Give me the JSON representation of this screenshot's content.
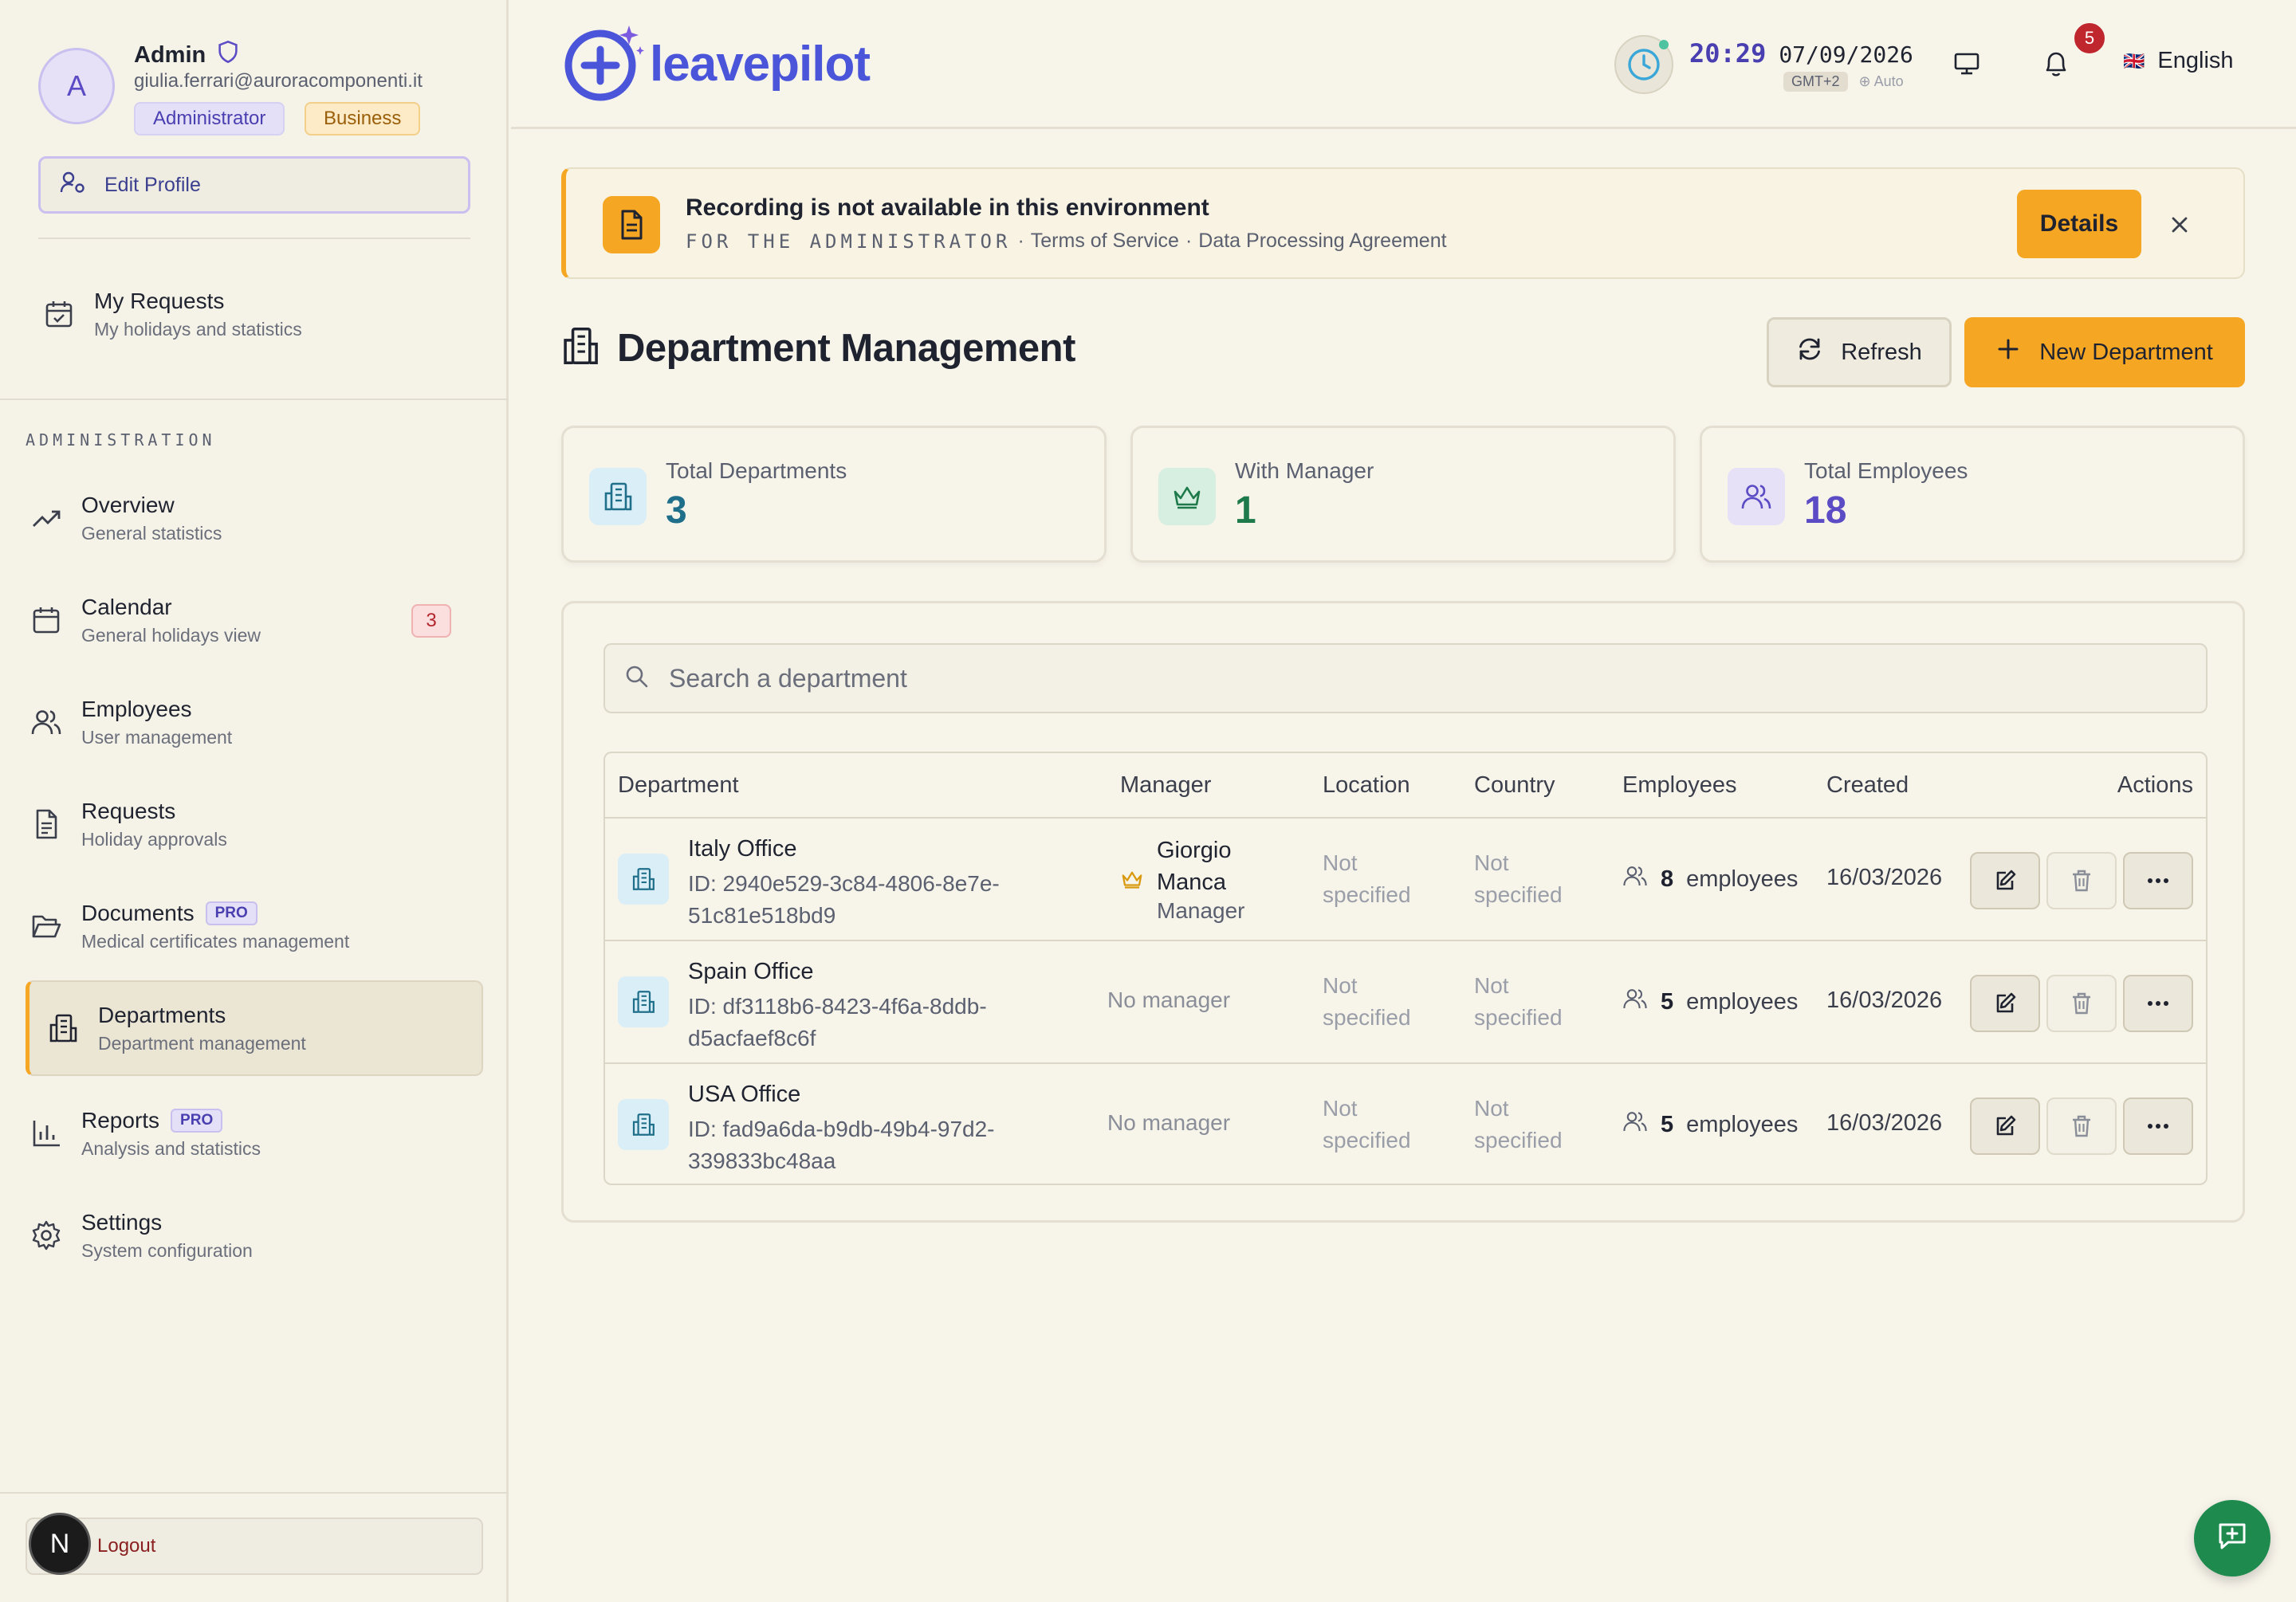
{
  "profile": {
    "initial": "A",
    "name": "Admin",
    "email": "giulia.ferrari@auroracomponenti.it",
    "role_badge": "Administrator",
    "plan_badge": "Business",
    "edit_label": "Edit Profile"
  },
  "sidebar": {
    "my_requests": {
      "title": "My Requests",
      "subtitle": "My holidays and statistics"
    },
    "section_label": "ADMINISTRATION",
    "items": [
      {
        "title": "Overview",
        "subtitle": "General statistics"
      },
      {
        "title": "Calendar",
        "subtitle": "General holidays view",
        "count": "3"
      },
      {
        "title": "Employees",
        "subtitle": "User management"
      },
      {
        "title": "Requests",
        "subtitle": "Holiday approvals"
      },
      {
        "title": "Documents",
        "subtitle": "Medical certificates management",
        "badge": "PRO"
      },
      {
        "title": "Departments",
        "subtitle": "Department management"
      },
      {
        "title": "Reports",
        "subtitle": "Analysis and statistics",
        "badge": "PRO"
      },
      {
        "title": "Settings",
        "subtitle": "System configuration"
      }
    ],
    "logout_label": "Logout",
    "next_logo": "N"
  },
  "header": {
    "logo_text": "leavepilot",
    "time": "20:29",
    "date": "07/09/2026",
    "timezone": "GMT+2",
    "tz_mode": "⊕ Auto",
    "notification_count": "5",
    "language": "English",
    "flag": "🇬🇧"
  },
  "banner": {
    "title": "Recording is not available in this environment",
    "prefix": "FOR THE ADMINISTRATOR",
    "sep1": "·",
    "link1": "Terms of Service",
    "sep2": "·",
    "link2": "Data Processing Agreement",
    "details_label": "Details"
  },
  "page": {
    "title": "Department Management",
    "refresh_label": "Refresh",
    "new_label": "New Department"
  },
  "stats": [
    {
      "label": "Total Departments",
      "value": "3",
      "color": "#1f6f8b"
    },
    {
      "label": "With Manager",
      "value": "1",
      "color": "#1e7a4a"
    },
    {
      "label": "Total Employees",
      "value": "18",
      "color": "#5b4bc4"
    }
  ],
  "search": {
    "placeholder": "Search a department"
  },
  "table": {
    "headers": [
      "Department",
      "Manager",
      "Location",
      "Country",
      "Employees",
      "Created",
      "Actions"
    ],
    "rows": [
      {
        "name": "Italy Office",
        "id": "ID: 2940e529-3c84-4806-8e7e-51c81e518bd9",
        "manager_name": "Giorgio Manca",
        "manager_role": "Manager",
        "location": "Not specified",
        "country": "Not specified",
        "employees_count": "8",
        "employees_label": "employees",
        "created": "16/03/2026"
      },
      {
        "name": "Spain Office",
        "id": "ID: df3118b6-8423-4f6a-8ddb-d5acfaef8c6f",
        "manager_name": "No manager",
        "location": "Not specified",
        "country": "Not specified",
        "employees_count": "5",
        "employees_label": "employees",
        "created": "16/03/2026"
      },
      {
        "name": "USA Office",
        "id": "ID: fad9a6da-b9db-49b4-97d2-339833bc48aa",
        "manager_name": "No manager",
        "location": "Not specified",
        "country": "Not specified",
        "employees_count": "5",
        "employees_label": "employees",
        "created": "16/03/2026"
      }
    ]
  },
  "colors": {
    "accent": "#f5a623",
    "brand": "#4b55d9",
    "background": "#f7f4ea"
  }
}
